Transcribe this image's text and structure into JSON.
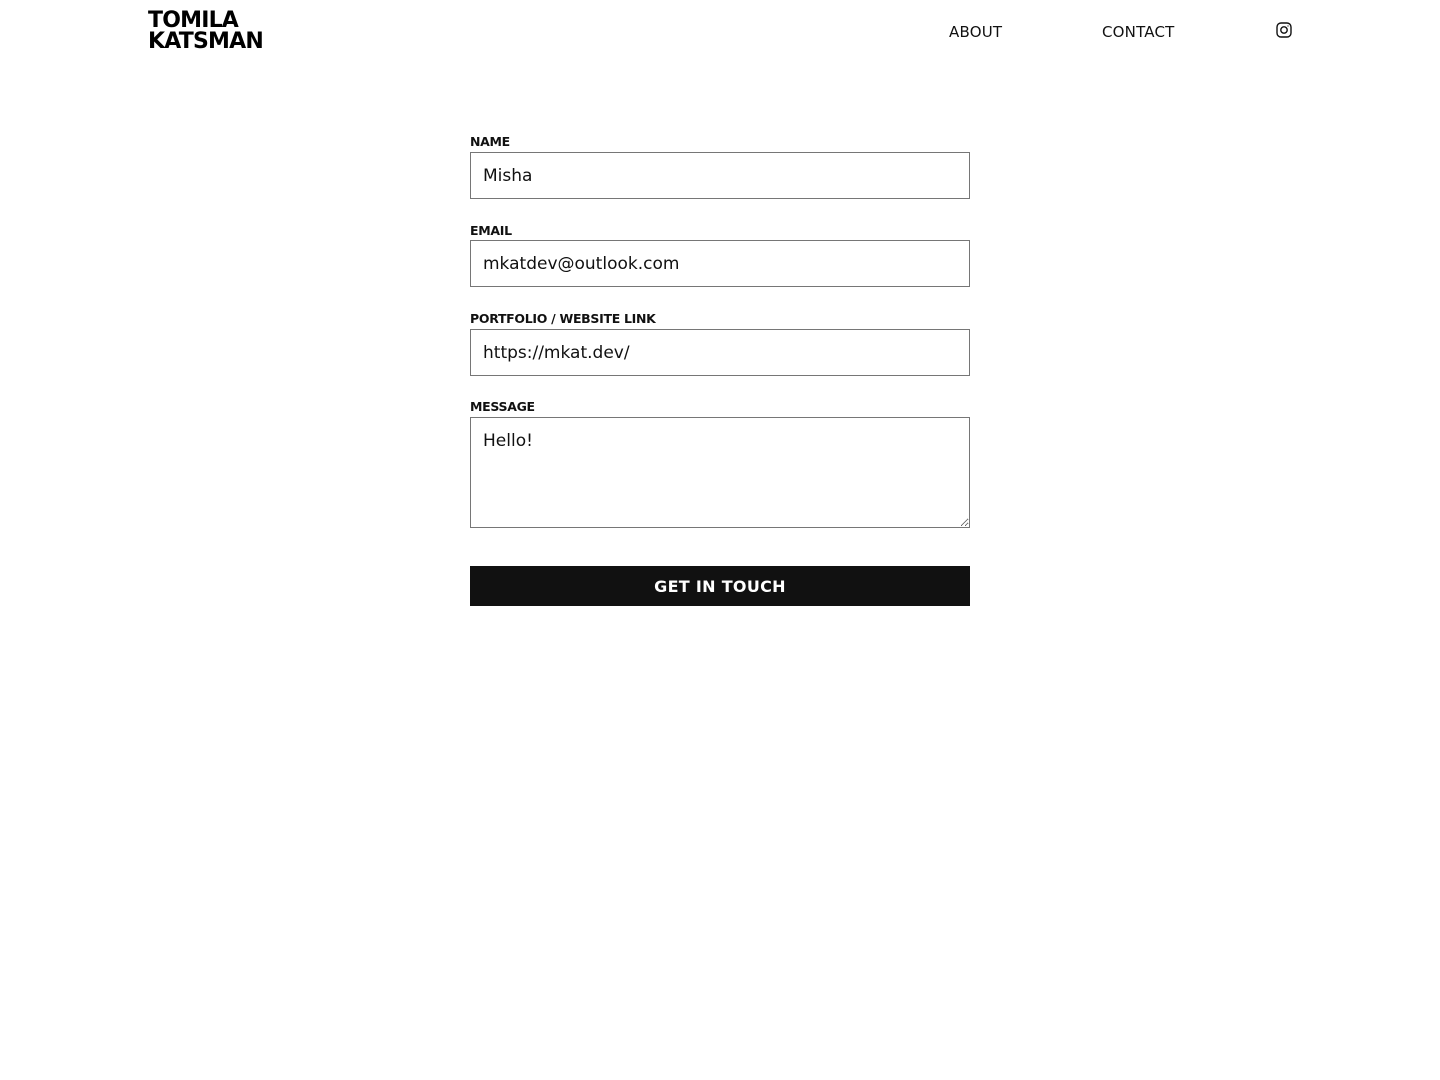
{
  "header": {
    "logo": {
      "line1": "TOMILA",
      "line2": "KATSMAN"
    },
    "nav": {
      "about": "ABOUT",
      "contact": "CONTACT"
    },
    "social_icon": "instagram-icon"
  },
  "form": {
    "name": {
      "label": "NAME",
      "value": "Misha"
    },
    "email": {
      "label": "EMAIL",
      "value": "mkatdev@outlook.com"
    },
    "portfolio": {
      "label": "PORTFOLIO / WEBSITE LINK",
      "value": "https://mkat.dev/"
    },
    "message": {
      "label": "MESSAGE",
      "value": "Hello!"
    },
    "submit_label": "GET IN TOUCH"
  },
  "colors": {
    "text": "#111111",
    "button_bg": "#111111",
    "button_text": "#ffffff",
    "input_border": "#767676",
    "background": "#ffffff"
  }
}
